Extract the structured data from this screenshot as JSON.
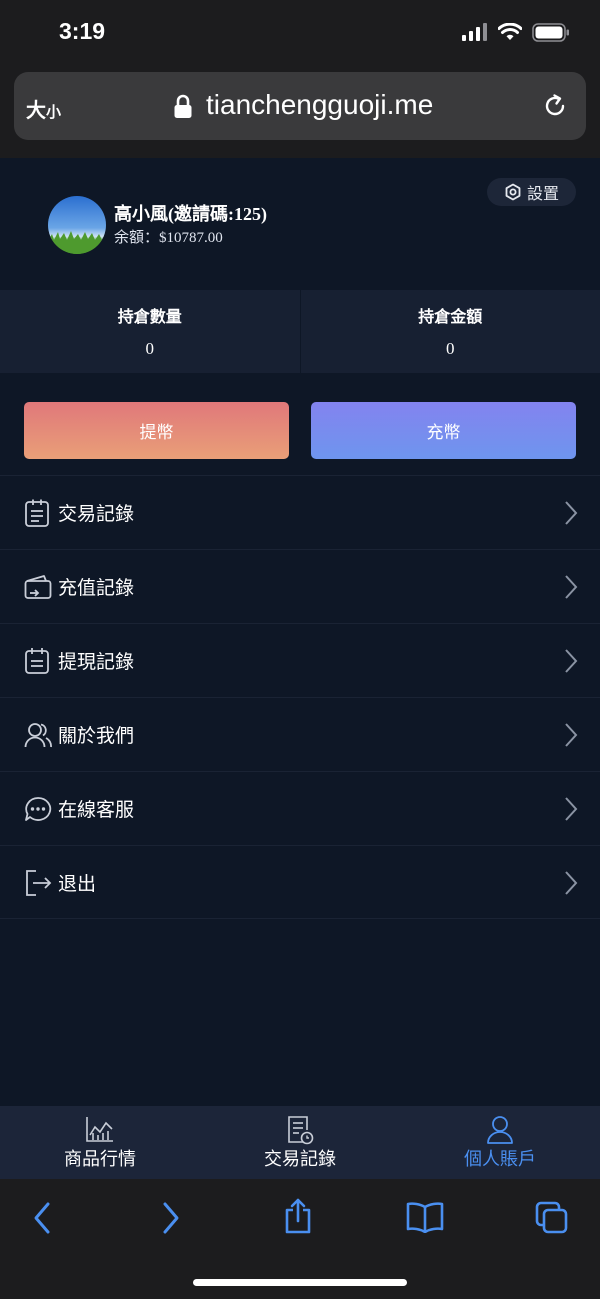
{
  "status_bar": {
    "time": "3:19"
  },
  "browser": {
    "text_size_label_big": "大",
    "text_size_label_small": "小",
    "url": "tianchengguoji.me"
  },
  "profile": {
    "name": "高小風(邀請碼:125)",
    "balance": "余額：$10787.00",
    "settings_label": "設置"
  },
  "positions": {
    "quantity_label": "持倉數量",
    "quantity_value": "0",
    "amount_label": "持倉金額",
    "amount_value": "0"
  },
  "actions": {
    "withdraw_label": "提幣",
    "deposit_label": "充幣"
  },
  "menu": {
    "items": [
      {
        "label": "交易記錄",
        "icon": "clipboard-list-icon"
      },
      {
        "label": "充值記錄",
        "icon": "wallet-icon"
      },
      {
        "label": "提現記錄",
        "icon": "calendar-list-icon"
      },
      {
        "label": "關於我們",
        "icon": "users-icon"
      },
      {
        "label": "在線客服",
        "icon": "chat-bubble-icon"
      },
      {
        "label": "退出",
        "icon": "logout-icon"
      }
    ]
  },
  "tabbar": {
    "items": [
      {
        "label": "商品行情",
        "icon": "market-chart-icon",
        "active": false
      },
      {
        "label": "交易記錄",
        "icon": "document-clock-icon",
        "active": false
      },
      {
        "label": "個人賬戶",
        "icon": "person-icon",
        "active": true
      }
    ]
  },
  "colors": {
    "background": "#0e1726",
    "withdraw_gradient": [
      "#e0787a",
      "#e99f78"
    ],
    "deposit_gradient": [
      "#8383ef",
      "#6e95ee"
    ],
    "active_tab": "#4a8ff0"
  }
}
